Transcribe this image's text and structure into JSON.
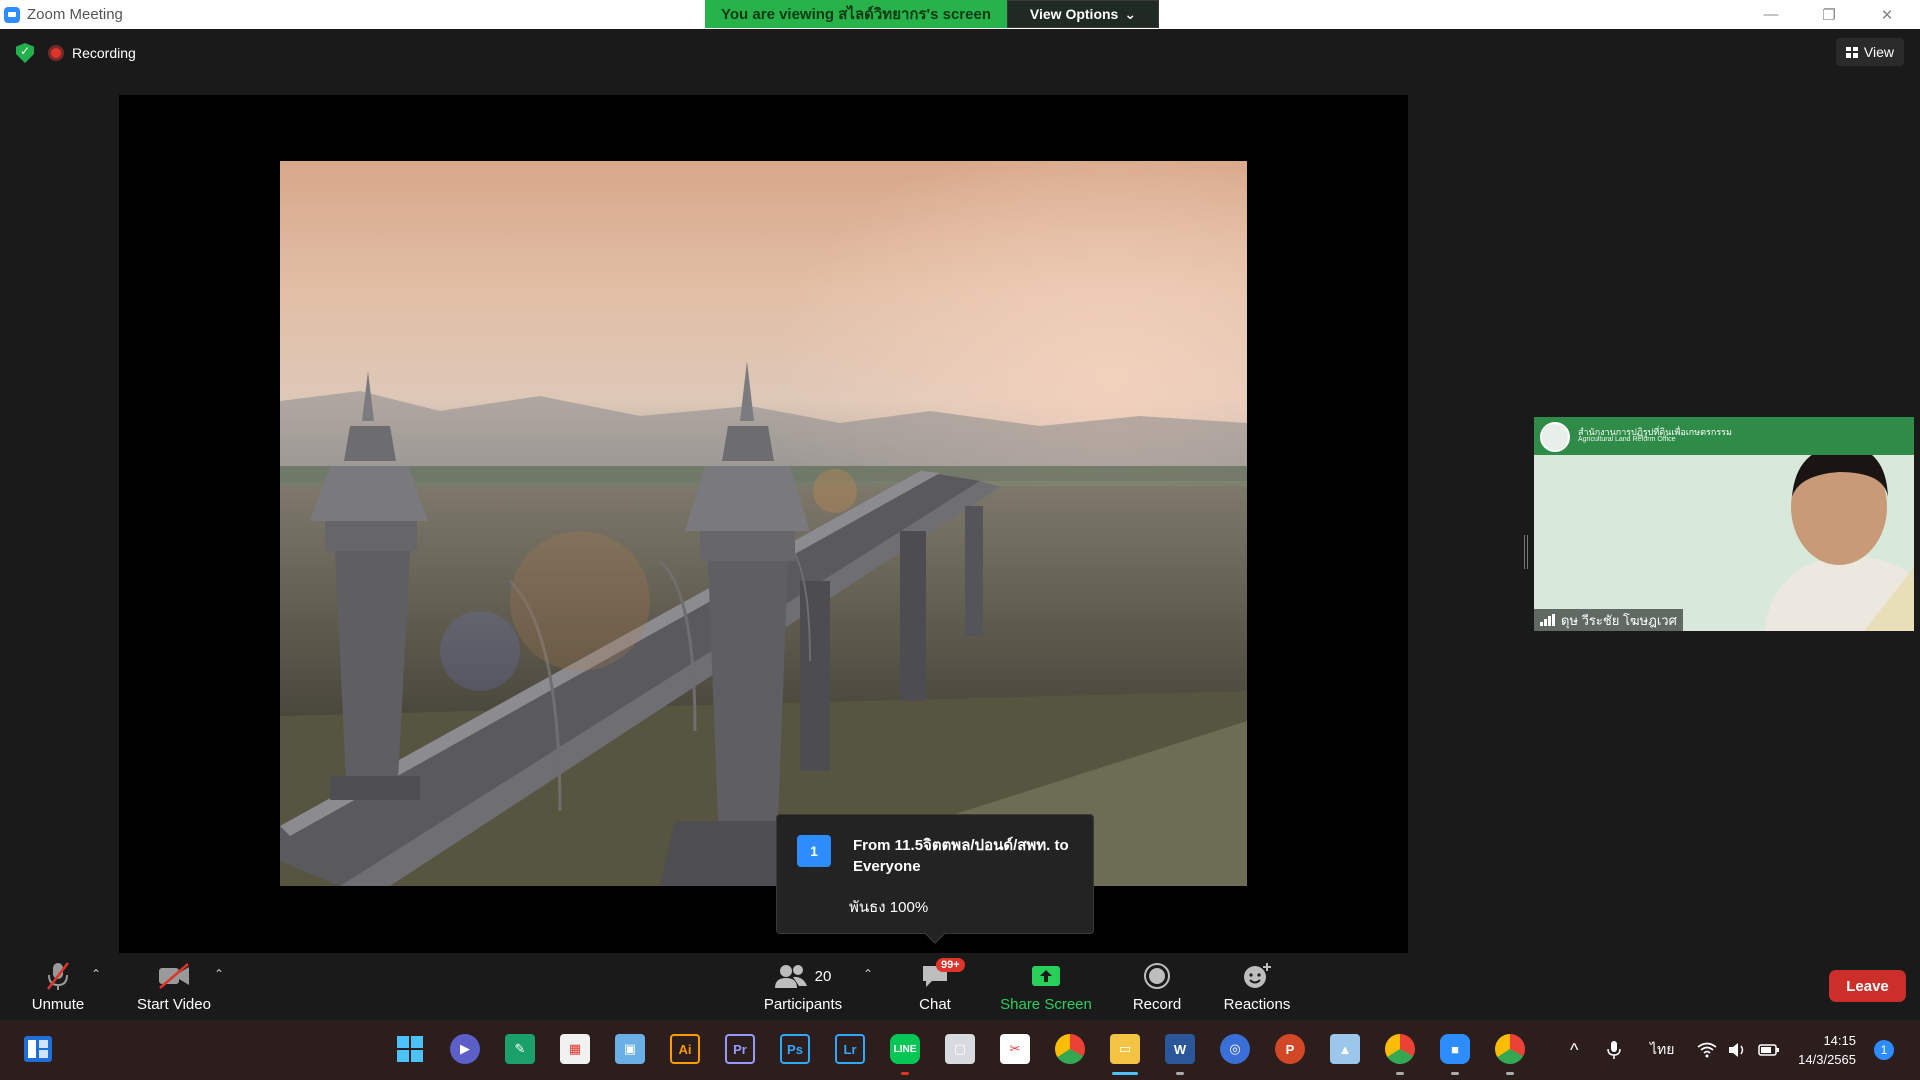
{
  "window": {
    "title": "Zoom Meeting",
    "minimize": "—",
    "restore": "❐",
    "close": "✕"
  },
  "banner": {
    "viewing_text": "You are viewing สไลด์วิทยากร's screen",
    "view_options_label": "View Options",
    "view_options_caret": "⌄"
  },
  "status": {
    "recording_label": "Recording",
    "view_label": "View"
  },
  "chat_notification": {
    "count": "1",
    "from_line": "From 11.5จิตตพล/ปอนด์/สพท. to Everyone",
    "message": "พันธง 100%"
  },
  "participant_video": {
    "org_name_th": "สำนักงานการปฏิรูปที่ดินเพื่อเกษตรกรรม",
    "org_name_en": "Agricultural Land Reform Office",
    "participant_name": "ดุษ วีระชัย โฆษฎเวศ"
  },
  "toolbar": {
    "unmute_label": "Unmute",
    "start_video_label": "Start Video",
    "participants_label": "Participants",
    "participants_count": "20",
    "chat_label": "Chat",
    "chat_badge": "99+",
    "share_label": "Share Screen",
    "record_label": "Record",
    "reactions_label": "Reactions",
    "leave_label": "Leave",
    "caret": "⌃"
  },
  "taskbar": {
    "apps": [
      {
        "name": "Illustrator",
        "text": "Ai",
        "color": "#2b1500",
        "fg": "#ff9a00"
      },
      {
        "name": "Premiere",
        "text": "Pr",
        "color": "#1f0f3a",
        "fg": "#9999ff"
      },
      {
        "name": "Photoshop",
        "text": "Ps",
        "color": "#001e36",
        "fg": "#31a8ff"
      },
      {
        "name": "Lightroom",
        "text": "Lr",
        "color": "#001a2e",
        "fg": "#31a8ff"
      }
    ],
    "tray_expand": "^",
    "language": "ไทย",
    "time": "14:15",
    "date": "14/3/2565",
    "notification_count": "1"
  },
  "colors": {
    "accent_green": "#28b34a",
    "leave_red": "#cc2f2a",
    "zoom_blue": "#2d8cff"
  }
}
